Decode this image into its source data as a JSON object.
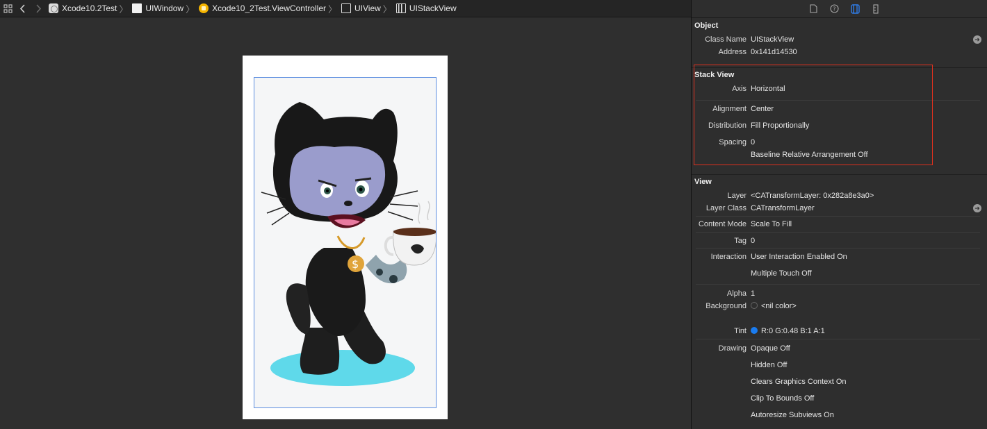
{
  "jumpbar": {
    "crumbs": [
      {
        "label": "Xcode10.2Test",
        "icon": "xcode-project-icon"
      },
      {
        "label": "UIWindow",
        "icon": "window-icon"
      },
      {
        "label": "Xcode10_2Test.ViewController",
        "icon": "view-controller-icon"
      },
      {
        "label": "UIView",
        "icon": "view-icon"
      },
      {
        "label": "UIStackView",
        "icon": "stack-view-icon"
      }
    ]
  },
  "inspector": {
    "object": {
      "title": "Object",
      "class_name_label": "Class Name",
      "class_name": "UIStackView",
      "address_label": "Address",
      "address": "0x141d14530"
    },
    "stack_view": {
      "title": "Stack View",
      "axis_label": "Axis",
      "axis": "Horizontal",
      "alignment_label": "Alignment",
      "alignment": "Center",
      "distribution_label": "Distribution",
      "distribution": "Fill Proportionally",
      "spacing_label": "Spacing",
      "spacing": "0",
      "baseline": "Baseline Relative Arrangement Off"
    },
    "view": {
      "title": "View",
      "layer_label": "Layer",
      "layer": "<CATransformLayer: 0x282a8e3a0>",
      "layer_class_label": "Layer Class",
      "layer_class": "CATransformLayer",
      "content_mode_label": "Content Mode",
      "content_mode": "Scale To Fill",
      "tag_label": "Tag",
      "tag": "0",
      "interaction_label": "Interaction",
      "user_interaction": "User Interaction Enabled On",
      "multiple_touch": "Multiple Touch Off",
      "alpha_label": "Alpha",
      "alpha": "1",
      "background_label": "Background",
      "background": "<nil color>",
      "tint_label": "Tint",
      "tint": "R:0 G:0.48 B:1 A:1",
      "tint_color": "#1a7cf0",
      "drawing_label": "Drawing",
      "opaque": "Opaque Off",
      "hidden": "Hidden Off",
      "clears": "Clears Graphics Context On",
      "clip": "Clip To Bounds Off",
      "autoresize": "Autoresize Subviews On"
    }
  },
  "colors": {
    "highlight": "#e0301e",
    "stack_border": "#5b8de0",
    "accent": "#1a7cf0"
  }
}
